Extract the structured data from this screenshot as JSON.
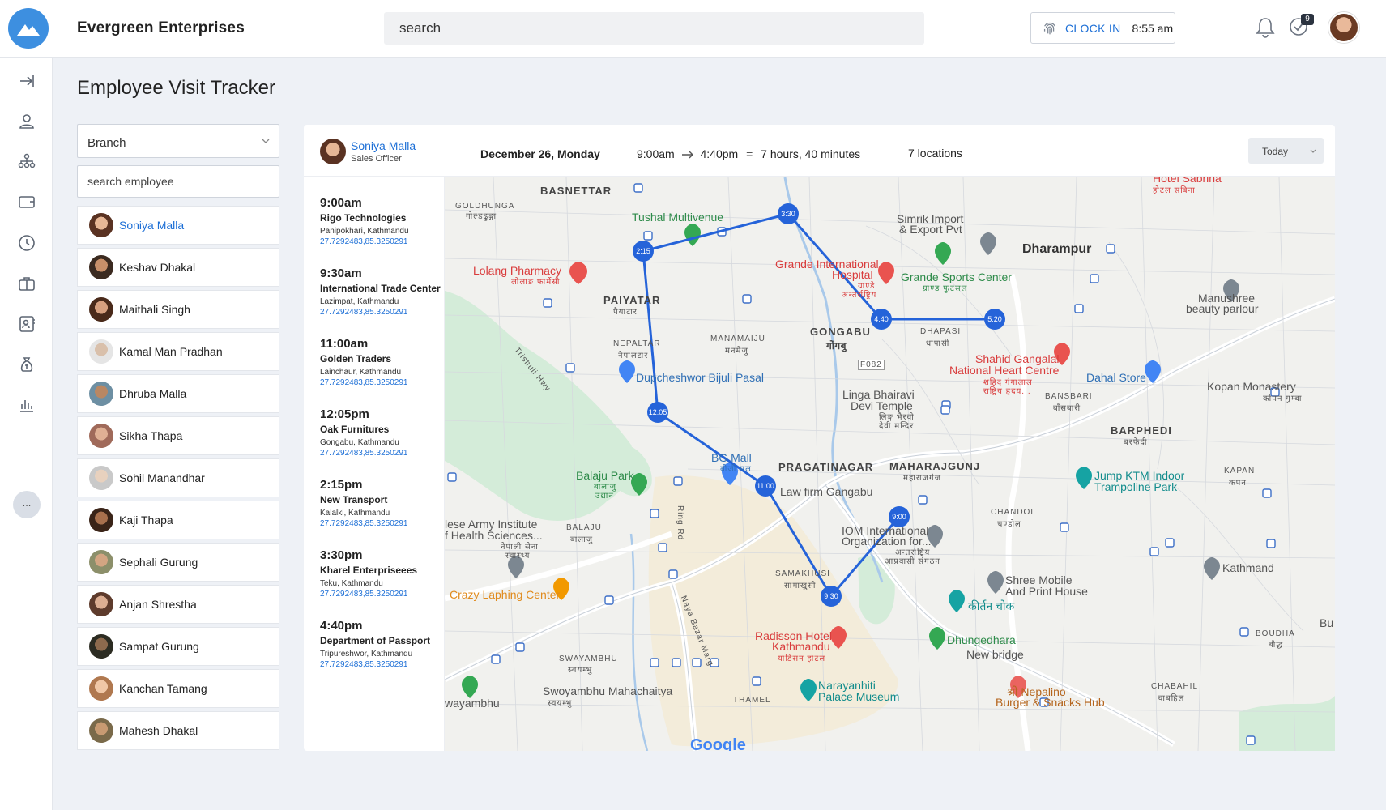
{
  "app": {
    "company": "Evergreen Enterprises",
    "search_placeholder": "search",
    "clock_label": "CLOCK IN",
    "clock_time": "8:55 am",
    "notification_badge": "9",
    "accent_color": "#1d6fd6"
  },
  "page": {
    "title": "Employee Visit Tracker"
  },
  "filters": {
    "branch_value": "Branch",
    "employee_search_placeholder": "search employee"
  },
  "sidebar": {
    "items": [
      "collapse-icon",
      "user-icon",
      "org-chart-icon",
      "wallet-icon",
      "clock-icon",
      "briefcase-icon",
      "contact-icon",
      "money-bag-icon",
      "bar-chart-icon",
      "more-icon"
    ],
    "more_label": "..."
  },
  "employees": [
    {
      "name": "Soniya Malla",
      "active": true
    },
    {
      "name": "Keshav Dhakal"
    },
    {
      "name": "Maithali Singh"
    },
    {
      "name": "Kamal Man Pradhan"
    },
    {
      "name": "Dhruba Malla"
    },
    {
      "name": "Sikha Thapa"
    },
    {
      "name": "Sohil Manandhar"
    },
    {
      "name": "Kaji Thapa"
    },
    {
      "name": "Sephali Gurung"
    },
    {
      "name": "Anjan Shrestha"
    },
    {
      "name": "Sampat Gurung"
    },
    {
      "name": "Kanchan Tamang"
    },
    {
      "name": "Mahesh Dhakal"
    }
  ],
  "tracker": {
    "employee_name": "Soniya Malla",
    "employee_role": "Sales Officer",
    "date": "December 26, Monday",
    "start": "9:00am",
    "end": "4:40pm",
    "equals": "=",
    "duration": "7 hours, 40 minutes",
    "locations": "7 locations",
    "range_select": "Today"
  },
  "visits": [
    {
      "time": "9:00am",
      "name": "Rigo Technologies",
      "address": "Panipokhari, Kathmandu",
      "coords": "27.7292483,85.3250291"
    },
    {
      "time": "9:30am",
      "name": "International Trade Center",
      "address": "Lazimpat, Kathmandu",
      "coords": "27.7292483,85.3250291"
    },
    {
      "time": "11:00am",
      "name": "Golden Traders",
      "address": "Lainchaur, Kathmandu",
      "coords": "27.7292483,85.3250291"
    },
    {
      "time": "12:05pm",
      "name": "Oak Furnitures",
      "address": "Gongabu, Kathmandu",
      "coords": "27.7292483,85.3250291"
    },
    {
      "time": "2:15pm",
      "name": "New Transport",
      "address": "Kalalki, Kathmandu",
      "coords": "27.7292483,85.3250291"
    },
    {
      "time": "3:30pm",
      "name": "Kharel Enterpriseees",
      "address": "Teku, Kathmandu",
      "coords": "27.7292483,85.3250291"
    },
    {
      "time": "4:40pm",
      "name": "Department of Passport",
      "address": "Tripureshwor, Kathmandu",
      "coords": "27.7292483,85.3250291"
    }
  ],
  "map": {
    "route_color": "#2563d9",
    "stops": [
      "9:00",
      "9:30",
      "11:00",
      "12:05",
      "2:15",
      "3:30",
      "4:40",
      "5:20"
    ],
    "labels": {
      "basnettar": "BASNETTAR",
      "goldhunga": "GOLDHUNGA",
      "goldhunga_dev": "गोल्डढुङ्गा",
      "tushal": "Tushal Multivenue",
      "simrik": "Simrik Import",
      "simrik2": "& Export Pvt",
      "dharampur": "Dharampur",
      "hotel_sabrina": "Hotel Sabrina",
      "hotel_sabrina_dev": "होटल सबिना",
      "lolang": "Lolang Pharmacy",
      "lolang_dev": "लोलाङ फार्मेसी",
      "grande_intl": "Grande International",
      "hospital": "Hospital",
      "grande_dev": "ग्राण्डे",
      "grande_dev2": "अन्तर्राष्ट्रिय",
      "grande_sports": "Grande Sports Center",
      "grande_sports_dev": "ग्राण्ड फुटसल",
      "manushree": "Manushree",
      "beauty": "beauty parlour",
      "paiyatar": "PAIYATAR",
      "paiyatar_dev": "पैयाटार",
      "gongabu": "GONGABU",
      "gongabu_dev": "गोंगबु",
      "dhapasi": "DHAPASI",
      "dhapasi_dev": "धापासी",
      "nepaltar": "NEPALTAR",
      "nepaltar_dev": "नेपालटार",
      "manamaiju": "MANAMAIJU",
      "manamaiju_dev": "मनमैजु",
      "f082": "F082",
      "shahid": "Shahid Gangalal",
      "heart_centre": "National Heart Centre",
      "shahid_dev": "शहिद गंगालाल",
      "shahid_dev2": "राष्ट्रिय हृदय...",
      "trishuli": "Trishuli Hwy",
      "dupcheshwor": "Dupcheshwor Bijuli Pasal",
      "dahal": "Dahal Store",
      "kopan_monastery": "Kopan Monastery",
      "kopan_dev": "कोपन गुम्बा",
      "linga": "Linga Bhairavi",
      "devi": "Devi Temple",
      "linga_dev": "लिङ्ग भैरवी",
      "linga_dev2": "देवी मन्दिर",
      "bansbari": "BANSBARI",
      "bansbari_dev": "बाँसबारी",
      "barphedi": "BARPHEDI",
      "barphedi_dev": "बरफेदी",
      "bg_mall": "BG Mall",
      "bg_mall_dev": "बीजी मल",
      "pragatinagar": "PRAGATINAGAR",
      "maharajgunj": "MAHARAJGUNJ",
      "maharajgunj_dev": "महाराजगंज",
      "jump": "Jump KTM Indoor",
      "trampoline": "Trampoline Park",
      "kapan": "KAPAN",
      "kapan_dev": "कपन",
      "balaju_park": "Balaju Park",
      "balaju_park_dev": "बालाजु",
      "balaju_park_dev2": "उद्यान",
      "lawfirm": "Law firm Gangabu",
      "army1": "lese Army Institute",
      "army2": "f Health Sciences...",
      "army_dev": "नेपाली सेना",
      "army_dev2": "स्वास्थ्य",
      "balaju": "BALAJU",
      "balaju_dev": "बालाजु",
      "ringrd": "Ring Rd",
      "iom": "IOM International",
      "iom2": "Organization for...",
      "iom_dev": "अन्तर्राष्ट्रिय",
      "iom_dev2": "आप्रवासी संगठन",
      "chandol": "CHANDOL",
      "chandol_dev": "चण्डोल",
      "crazy": "Crazy Laphing Center",
      "samakhusi": "SAMAKHUSI",
      "samakhusi_dev": "सामाखुसी",
      "shree_mobile": "Shree Mobile",
      "print_house": "And Print House",
      "kathmand": "Kathmand",
      "kirtan": "कीर्तन चोक",
      "naya_bazar": "Naya Bazar Marg",
      "radisson": "Radisson Hotel",
      "radisson2": "Kathmandu",
      "radisson_dev": "र्याडिसन होटल",
      "dhungedhara": "Dhungedhara",
      "new_bridge": "New bridge",
      "bu": "Bu",
      "boudha": "BOUDHA",
      "boudha_dev": "बौद्ध",
      "swayambhu": "SWAYAMBHU",
      "swayambhu_dev": "स्वयम्भु",
      "swayambhu_mc": "Swoyambhu Mahachaitya",
      "swayambhu_mc_dev": "स्वयम्भु",
      "waymbhu": "wayambhu",
      "narayanhiti": "Narayanhiti",
      "palace": "Palace Museum",
      "thamel": "THAMEL",
      "nepalino": "श्री Nepalino",
      "burger": "Burger & Snacks Hub",
      "chabahil": "CHABAHIL",
      "chabahil_dev": "चाबहिल",
      "google": "Google"
    }
  }
}
